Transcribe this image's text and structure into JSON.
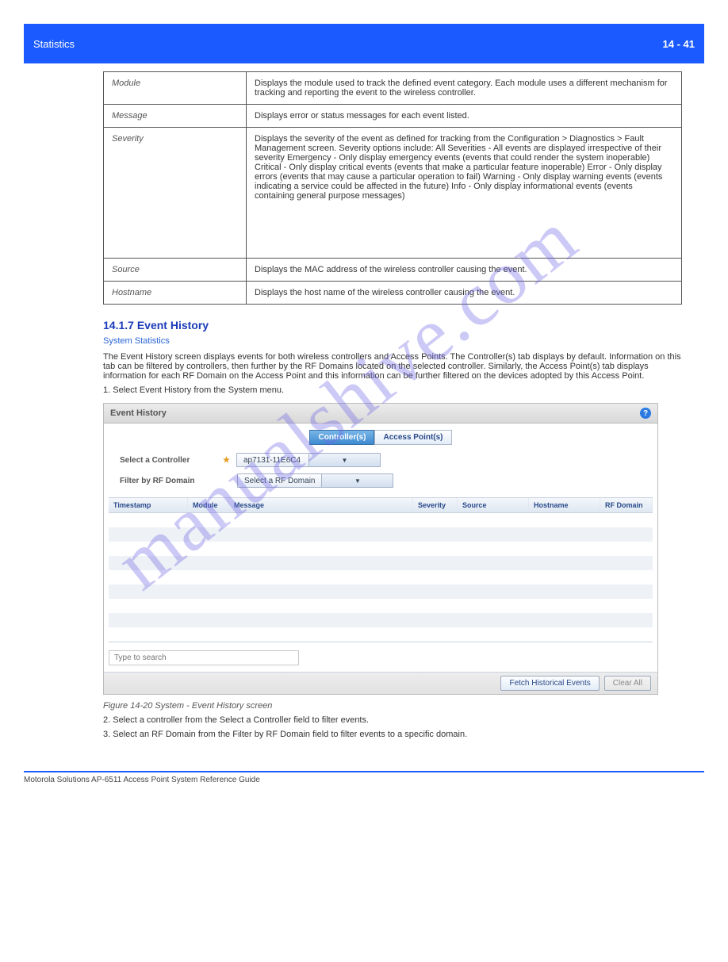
{
  "header": {
    "left": "Statistics",
    "right": "14 - 41"
  },
  "definitions": [
    {
      "k": "Module",
      "v": "Displays the module used to track the defined event category. Each module uses a different mechanism for tracking and reporting the event to the wireless controller."
    },
    {
      "k": "Message",
      "v": "Displays error or status messages for each event listed."
    },
    {
      "k": "Severity",
      "v": "Displays the severity of the event as defined for tracking from the Configuration > Diagnostics > Fault Management screen. Severity options include:\nAll Severities - All events are displayed irrespective of their severity\nEmergency - Only display emergency events (events that could render the system inoperable)\nCritical - Only display critical events (events that make a particular feature inoperable)\nError - Only display errors (events that may cause a particular operation to fail)\nWarning - Only display warning events (events indicating a service could be affected in the future)\nInfo - Only display informational events (events containing general purpose messages)"
    },
    {
      "k": "Source",
      "v": "Displays the MAC address of the wireless controller causing the event."
    },
    {
      "k": "Hostname",
      "v": "Displays the host name of the wireless controller causing the event."
    }
  ],
  "section_heading": "14.1.7 Event History",
  "section_crumb": "System Statistics",
  "body_para": "The Event History screen displays events for both wireless controllers and Access Points. The Controller(s) tab displays by default. Information on this tab can be filtered by controllers, then further by the RF Domains located on the selected controller. Similarly, the Access Point(s) tab displays information for each RF Domain on the Access Point and this information can be further filtered on the devices adopted by this Access Point.",
  "step_text": "1. Select Event History from the System menu.",
  "ui": {
    "title": "Event History",
    "help_char": "?",
    "tabs": {
      "controllers": "Controller(s)",
      "aps": "Access Point(s)"
    },
    "select_controller_label": "Select a Controller",
    "filter_label": "Filter by RF Domain",
    "controller_value": "ap7131-11E6C4",
    "rf_value": "Select a RF Domain",
    "columns": {
      "timestamp": "Timestamp",
      "module": "Module",
      "message": "Message",
      "severity": "Severity",
      "source": "Source",
      "hostname": "Hostname",
      "rfdomain": "RF Domain"
    },
    "search_placeholder": "Type to search",
    "buttons": {
      "fetch": "Fetch Historical Events",
      "clear": "Clear All"
    }
  },
  "figure_caption": "Figure 14-20 System - Event History screen",
  "post_fig_p1": "2. Select a controller from the Select a Controller field to filter events.",
  "post_fig_p2": "3. Select an RF Domain from the Filter by RF Domain field to filter events to a specific domain.",
  "footer": {
    "left": "Motorola Solutions AP-6511 Access Point System Reference Guide",
    "right": ""
  },
  "watermark": "manualshive.com"
}
